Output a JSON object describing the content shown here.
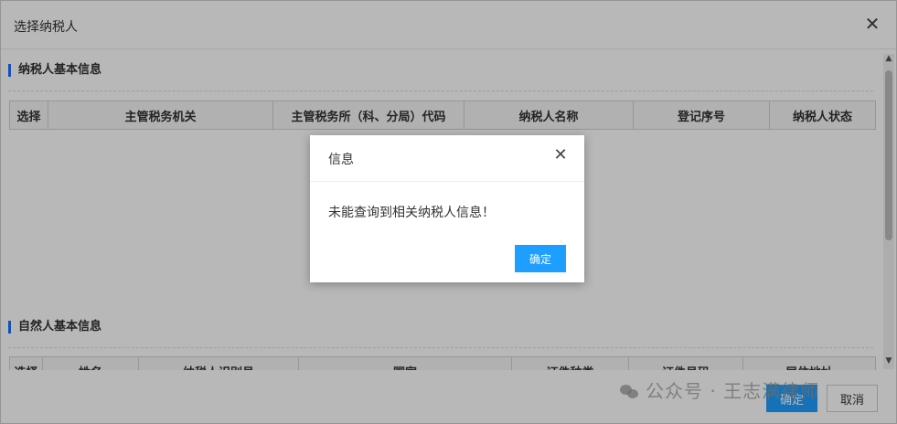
{
  "window": {
    "title": "选择纳税人",
    "close_glyph": "✕"
  },
  "section1": {
    "title": "纳税人基本信息",
    "columns": [
      "选择",
      "主管税务机关",
      "主管税务所（科、分局）代码",
      "纳税人名称",
      "登记序号",
      "纳税人状态"
    ]
  },
  "section2": {
    "title": "自然人基本信息",
    "columns": [
      "选择",
      "姓名",
      "纳税人识别号",
      "国家",
      "证件种类",
      "证件号码",
      "居住地址"
    ]
  },
  "footer": {
    "ok_label": "确定",
    "cancel_label": "取消"
  },
  "dialog": {
    "title": "信息",
    "close_glyph": "✕",
    "message": "未能查询到相关纳税人信息！",
    "ok_label": "确定"
  },
  "watermark": {
    "text": "公众号 · 王志满律师",
    "icon": "wechat-icon"
  },
  "colors": {
    "accent": "#1e9fff",
    "section_marker": "#1e6fff"
  }
}
